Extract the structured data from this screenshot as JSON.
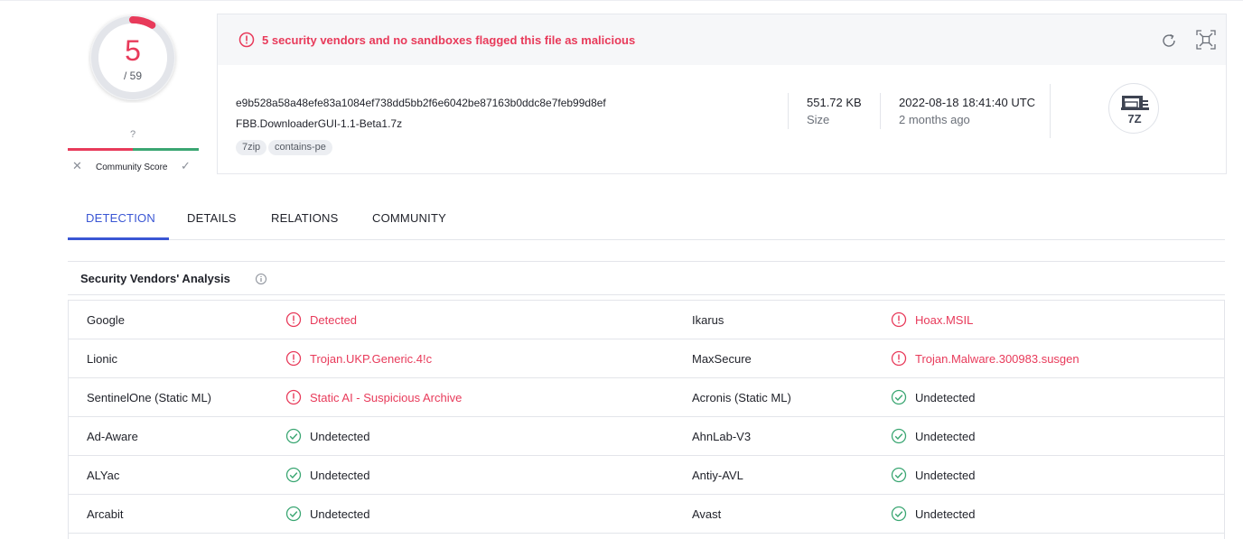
{
  "score": {
    "detections": "5",
    "total": "/ 59",
    "detection_fraction": 0.0847
  },
  "community": {
    "score": "?",
    "label": "Community Score"
  },
  "alert": {
    "text": "5 security vendors and no sandboxes flagged this file as malicious",
    "color": "#e83a5a"
  },
  "file": {
    "hash": "e9b528a58a48efe83a1084ef738dd5bb2f6e6042be87163b0ddc8e7feb99d8ef",
    "name": "FBB.DownloaderGUI-1.1-Beta1.7z",
    "tags": [
      "7zip",
      "contains-pe"
    ],
    "size_value": "551.72 KB",
    "size_label": "Size",
    "date_value": "2022-08-18 18:41:40 UTC",
    "date_ago": "2 months ago",
    "type_icon": "7z-archive-icon",
    "type_label": "7Z"
  },
  "tabs": [
    {
      "label": "DETECTION",
      "active": true
    },
    {
      "label": "DETAILS",
      "active": false
    },
    {
      "label": "RELATIONS",
      "active": false
    },
    {
      "label": "COMMUNITY",
      "active": false
    }
  ],
  "section": {
    "title": "Security Vendors' Analysis"
  },
  "vendors": [
    {
      "left": {
        "vendor": "Google",
        "result": "Detected",
        "status": "malicious"
      },
      "right": {
        "vendor": "Ikarus",
        "result": "Hoax.MSIL",
        "status": "malicious"
      }
    },
    {
      "left": {
        "vendor": "Lionic",
        "result": "Trojan.UKP.Generic.4!c",
        "status": "malicious"
      },
      "right": {
        "vendor": "MaxSecure",
        "result": "Trojan.Malware.300983.susgen",
        "status": "malicious"
      }
    },
    {
      "left": {
        "vendor": "SentinelOne (Static ML)",
        "result": "Static AI - Suspicious Archive",
        "status": "malicious"
      },
      "right": {
        "vendor": "Acronis (Static ML)",
        "result": "Undetected",
        "status": "undetected"
      }
    },
    {
      "left": {
        "vendor": "Ad-Aware",
        "result": "Undetected",
        "status": "undetected"
      },
      "right": {
        "vendor": "AhnLab-V3",
        "result": "Undetected",
        "status": "undetected"
      }
    },
    {
      "left": {
        "vendor": "ALYac",
        "result": "Undetected",
        "status": "undetected"
      },
      "right": {
        "vendor": "Antiy-AVL",
        "result": "Undetected",
        "status": "undetected"
      }
    },
    {
      "left": {
        "vendor": "Arcabit",
        "result": "Undetected",
        "status": "undetected"
      },
      "right": {
        "vendor": "Avast",
        "result": "Undetected",
        "status": "undetected"
      }
    }
  ],
  "colors": {
    "malicious": "#e83a5a",
    "undetected": "#3aa672",
    "accent": "#3a56d4"
  }
}
